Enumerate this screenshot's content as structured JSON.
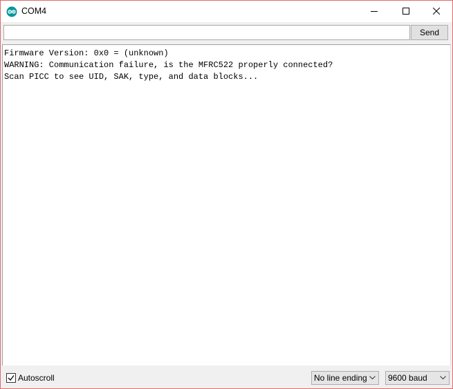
{
  "window": {
    "title": "COM4",
    "app_icon": "arduino-logo-icon",
    "controls": [
      "minimize-icon",
      "maximize-icon",
      "close-icon"
    ]
  },
  "send": {
    "input_value": "",
    "input_placeholder": "",
    "button_label": "Send"
  },
  "output": {
    "lines": [
      "Firmware Version: 0x0 = (unknown)",
      "WARNING: Communication failure, is the MFRC522 properly connected?",
      "Scan PICC to see UID, SAK, type, and data blocks..."
    ]
  },
  "status": {
    "autoscroll_label": "Autoscroll",
    "autoscroll_checked": true,
    "line_ending_value": "No line ending",
    "baud_value": "9600 baud"
  },
  "colors": {
    "accent_logo": "#00979c",
    "window_border": "#e06a6a"
  }
}
